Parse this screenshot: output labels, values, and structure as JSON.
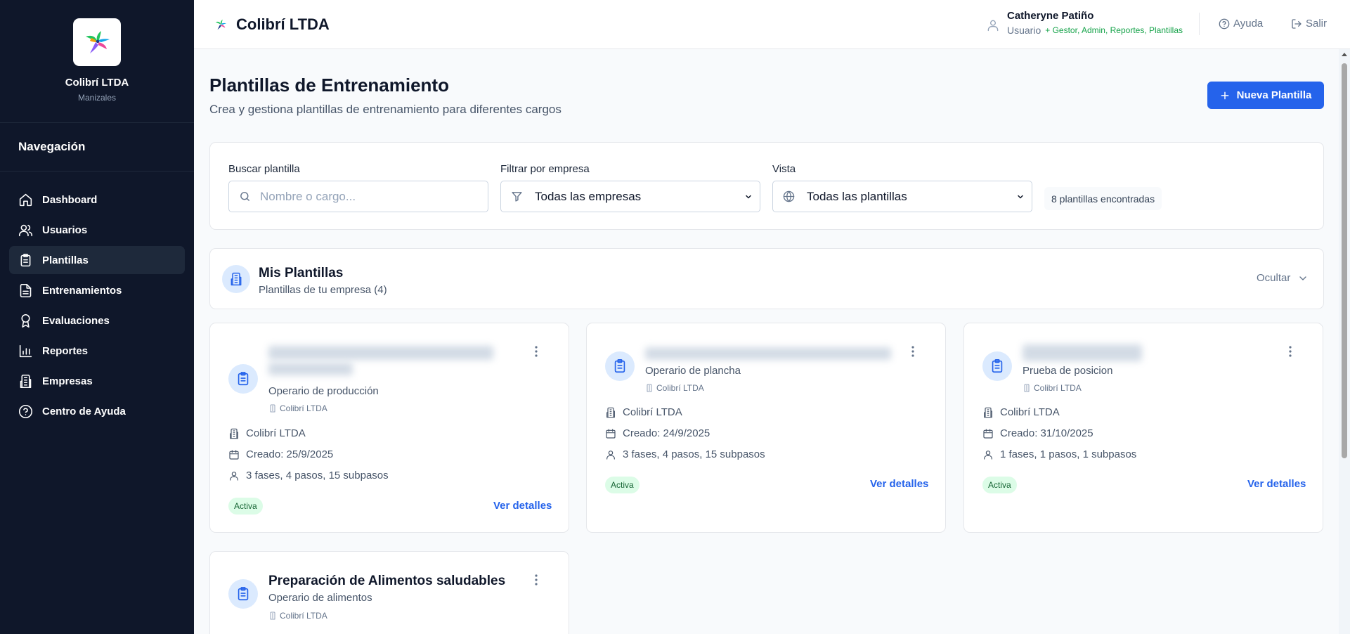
{
  "sidebar": {
    "brand_name": "Colibrí LTDA",
    "brand_city": "Manizales",
    "nav_title": "Navegación",
    "items": [
      {
        "label": "Dashboard",
        "icon": "home-icon"
      },
      {
        "label": "Usuarios",
        "icon": "users-icon"
      },
      {
        "label": "Plantillas",
        "icon": "clipboard-icon",
        "active": true
      },
      {
        "label": "Entrenamientos",
        "icon": "document-icon"
      },
      {
        "label": "Evaluaciones",
        "icon": "award-icon"
      },
      {
        "label": "Reportes",
        "icon": "bar-chart-icon"
      },
      {
        "label": "Empresas",
        "icon": "building-icon"
      },
      {
        "label": "Centro de Ayuda",
        "icon": "help-circle-icon"
      }
    ]
  },
  "header": {
    "title": "Colibrí LTDA",
    "user_name": "Catheryne Patiño",
    "user_role": "Usuario",
    "user_permissions": "+ Gestor, Admin, Reportes, Plantillas",
    "help_label": "Ayuda",
    "logout_label": "Salir"
  },
  "page": {
    "title": "Plantillas de Entrenamiento",
    "subtitle": "Crea y gestiona plantillas de entrenamiento para diferentes cargos",
    "new_button": "Nueva Plantilla"
  },
  "filters": {
    "search_label": "Buscar plantilla",
    "search_placeholder": "Nombre o cargo...",
    "company_label": "Filtrar por empresa",
    "company_value": "Todas las empresas",
    "view_label": "Vista",
    "view_value": "Todas las plantillas",
    "count_text": "8 plantillas encontradas"
  },
  "section": {
    "title": "Mis Plantillas",
    "subtitle": "Plantillas de tu empresa (4)",
    "toggle_label": "Ocultar"
  },
  "cards": [
    {
      "role": "Operario de producción",
      "company": "Colibrí LTDA",
      "created": "Creado: 25/9/2025",
      "stats": "3 fases, 4 pasos, 15 subpasos",
      "status": "Activa",
      "details": "Ver detalles"
    },
    {
      "role": "Operario de plancha",
      "company": "Colibrí LTDA",
      "created": "Creado: 24/9/2025",
      "stats": "3 fases, 4 pasos, 15 subpasos",
      "status": "Activa",
      "details": "Ver detalles"
    },
    {
      "role": "Prueba de posicion",
      "company": "Colibrí LTDA",
      "created": "Creado: 31/10/2025",
      "stats": "1 fases, 1 pasos, 1 subpasos",
      "status": "Activa",
      "details": "Ver detalles"
    },
    {
      "title": "Preparación de Alimentos saludables",
      "role": "Operario de alimentos",
      "company": "Colibrí LTDA"
    }
  ],
  "colors": {
    "sidebar_bg": "#0f172a",
    "accent": "#2563eb",
    "status_green": "#166534",
    "permission_green": "#16a34a"
  }
}
